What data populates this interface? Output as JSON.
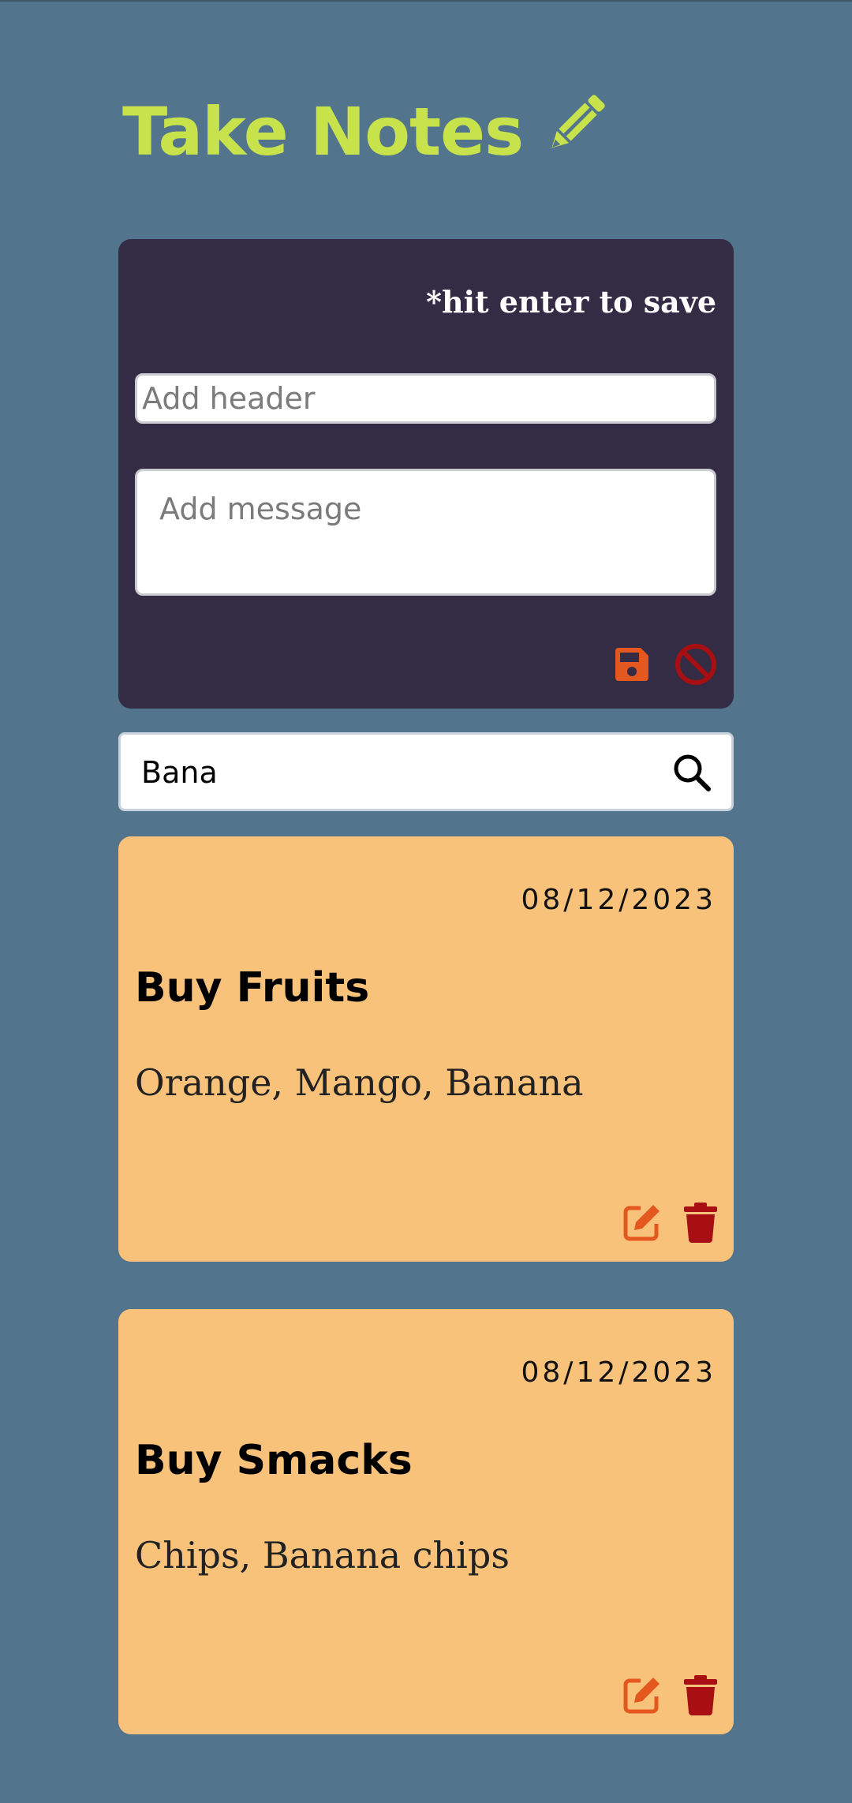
{
  "app": {
    "title": "Take Notes"
  },
  "editor": {
    "hint": "*hit enter to save",
    "header_placeholder": "Add header",
    "header_value": "",
    "message_placeholder": "Add message",
    "message_value": "",
    "save_icon": "floppy-disk-icon",
    "cancel_icon": "ban-icon"
  },
  "search": {
    "value": "Bana",
    "icon": "magnifier-icon"
  },
  "notes": [
    {
      "date": "08/12/2023",
      "title": "Buy Fruits",
      "body": "Orange, Mango, Banana"
    },
    {
      "date": "08/12/2023",
      "title": "Buy Smacks",
      "body": "Chips, Banana chips"
    }
  ],
  "colors": {
    "background": "#52748d",
    "title_accent": "#c7e24a",
    "editor_panel": "#342b44",
    "note_card": "#f8c27b",
    "edit_icon": "#e4581f",
    "delete_icon": "#a80f12",
    "save_icon": "#e4581f",
    "cancel_icon": "#a80f12"
  }
}
